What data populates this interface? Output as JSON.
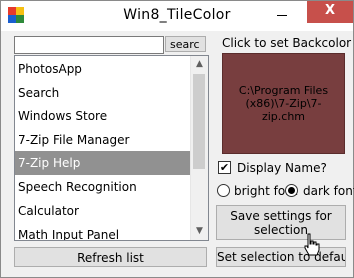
{
  "window": {
    "title": "Win8_TileColor"
  },
  "titlebar": {
    "close_symbol": "X"
  },
  "search": {
    "value": "",
    "button_label": "searc"
  },
  "list": {
    "items": [
      "PhotosApp",
      "Search",
      "Windows Store",
      "7-Zip File Manager",
      "7-Zip Help",
      "Speech Recognition",
      "Calculator",
      "Math Input Panel"
    ],
    "selected": "7-Zip Help"
  },
  "refresh_label": "Refresh list",
  "backcolor": {
    "label": "Click to set Backcolor",
    "color": "#783e3f",
    "path": "C:\\Program Files (x86)\\7-Zip\\7-zip.chm"
  },
  "display_name": {
    "label": "Display Name?",
    "checked": true,
    "mark": "✔"
  },
  "font_options": {
    "bright": "bright font",
    "dark": "dark font",
    "selected": "dark font"
  },
  "save_label": "Save settings for selection",
  "set_default_label": "Set selection to default"
}
